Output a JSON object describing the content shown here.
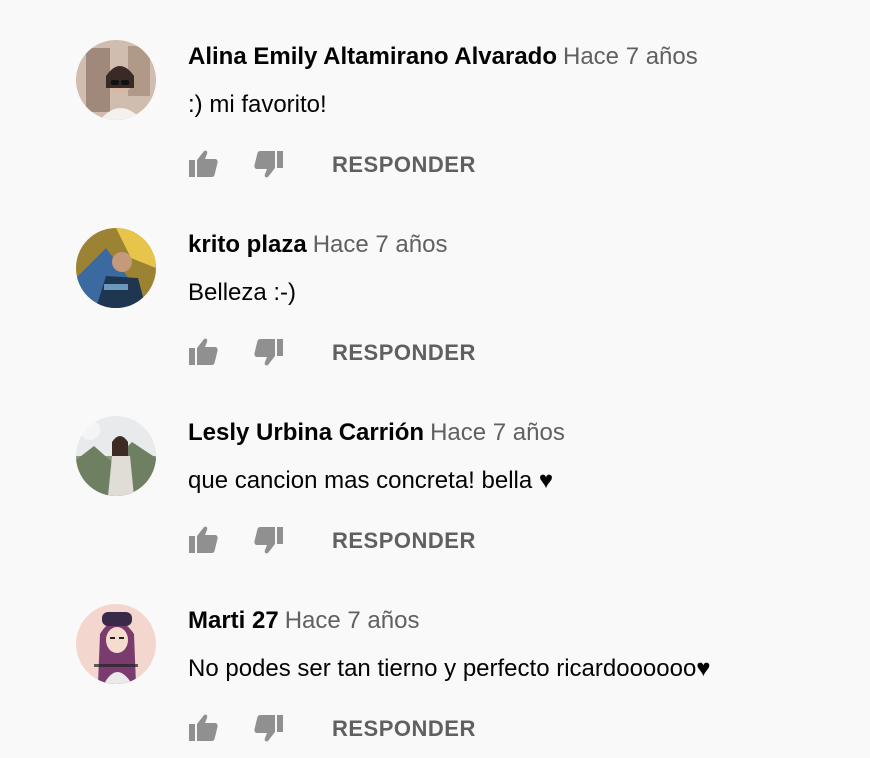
{
  "comments": [
    {
      "author": "Alina Emily Altamirano Alvarado",
      "time": "Hace 7 años",
      "text": ":) mi favorito!",
      "reply_label": "RESPONDER",
      "avatar_colors": {
        "bg": "#b89b86",
        "accent": "#efe6df"
      }
    },
    {
      "author": "krito plaza",
      "time": "Hace 7 años",
      "text": "Belleza :-)",
      "reply_label": "RESPONDER",
      "avatar_colors": {
        "bg": "#d9b338",
        "accent": "#3b6aa0"
      }
    },
    {
      "author": "Lesly Urbina Carrión",
      "time": "Hace 7 años",
      "text": "que cancion mas concreta! bella ♥",
      "reply_label": "RESPONDER",
      "avatar_colors": {
        "bg": "#8a9a7c",
        "accent": "#e8eaec"
      }
    },
    {
      "author": "Marti 27",
      "time": "Hace 7 años",
      "text": "No podes ser tan tierno y perfecto ricardoooooo♥",
      "reply_label": "RESPONDER",
      "avatar_colors": {
        "bg": "#f3d7ce",
        "accent": "#7a3c6e"
      }
    }
  ],
  "icons": {
    "like": "thumbs-up-icon",
    "dislike": "thumbs-down-icon"
  },
  "colors": {
    "background": "#f9f9f9",
    "author": "#030303",
    "meta": "#606060",
    "icon": "#909090"
  }
}
